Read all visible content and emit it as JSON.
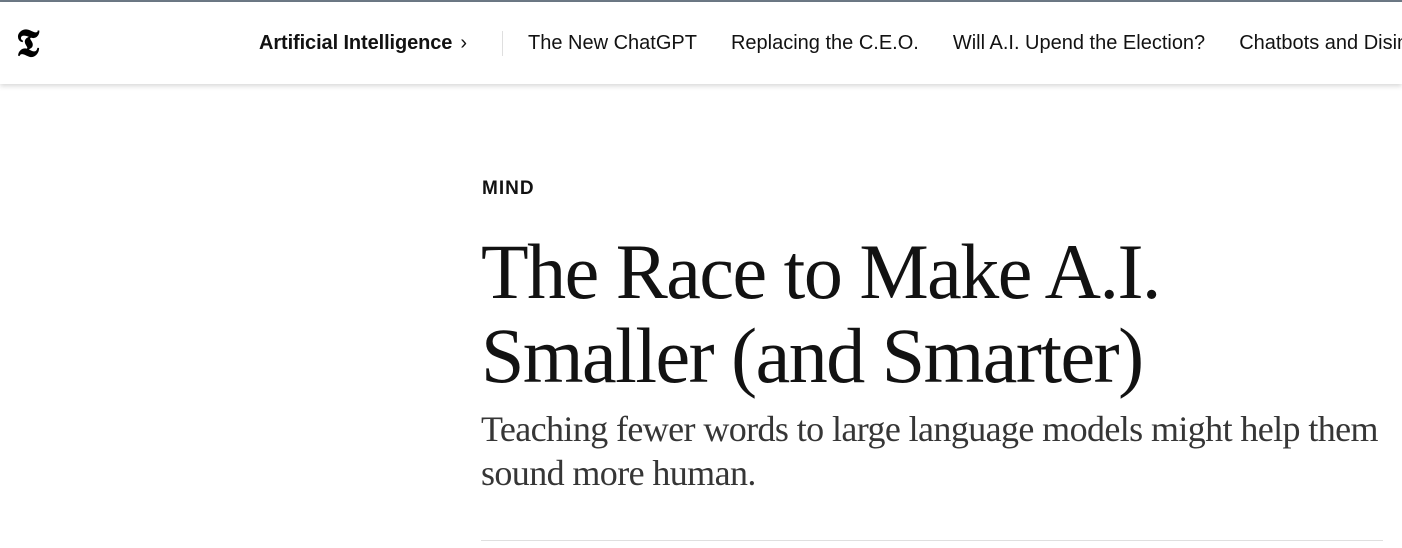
{
  "header": {
    "logo_icon": "nyt-t-logo-icon",
    "logo_glyph": "𝕿",
    "section": {
      "label": "Artificial Intelligence",
      "chevron": "›"
    },
    "nav_links": [
      "The New ChatGPT",
      "Replacing the C.E.O.",
      "Will A.I. Upend the Election?",
      "Chatbots and Disinformation"
    ]
  },
  "article": {
    "kicker": "MIND",
    "headline": "The Race to Make A.I. Smaller (and Smarter)",
    "summary": "Teaching fewer words to large language models might help them sound more human."
  },
  "colors": {
    "text": "#121212",
    "summary_text": "#363636",
    "divider": "#dfdfdf",
    "top_border": "#6e7a86"
  }
}
